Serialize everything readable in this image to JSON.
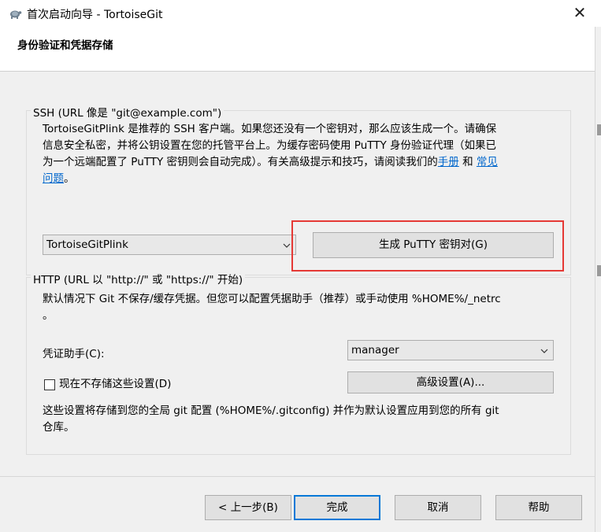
{
  "window": {
    "title": "首次启动向导 - TortoiseGit",
    "close_glyph": "✕",
    "icon": "tortoise-icon"
  },
  "header": {
    "title": "身份验证和凭据存储"
  },
  "ssh": {
    "group_title": "SSH (URL 像是 \"git@example.com\")",
    "lines": [
      "TortoiseGitPlink 是推荐的 SSH 客户端。如果您还没有一个密钥对，那么应该生成一个。请确保",
      "信息安全私密，并将公钥设置在您的托管平台上。为缓存密码使用 PuTTY 身份验证代理（如果已",
      "为一个远端配置了 PuTTY 密钥则会自动完成）。有关高级提示和技巧，请阅读我们的"
    ],
    "manual_link": "手册",
    "and_text": "和",
    "faq_link_part1": "常见",
    "faq_link_part2": "问题",
    "end_text": "。",
    "client_select": "TortoiseGitPlink",
    "generate_button": "生成 PuTTY 密钥对(G)"
  },
  "http": {
    "group_title": "HTTP (URL 以 \"http://\" 或 \"https://\" 开始)",
    "line1": "默认情况下 Git 不保存/缓存凭据。但您可以配置凭据助手（推荐）或手动使用 %HOME%/_netrc",
    "line2": "。",
    "helper_label": "凭证助手(C):",
    "helper_value": "manager",
    "dont_store_label": "现在不存储这些设置(D)",
    "dont_store_checked": false,
    "advanced_button": "高级设置(A)...",
    "note_line1": "这些设置将存储到您的全局 git 配置 (%HOME%/.gitconfig) 并作为默认设置应用到您的所有 git",
    "note_line2": "仓库。"
  },
  "footer": {
    "back_button": "< 上一步(B)",
    "finish_button": "完成",
    "cancel_button": "取消",
    "help_button": "帮助"
  },
  "colors": {
    "link": "#0066cc",
    "highlight": "#e53935",
    "default_button_border": "#0078d7"
  }
}
